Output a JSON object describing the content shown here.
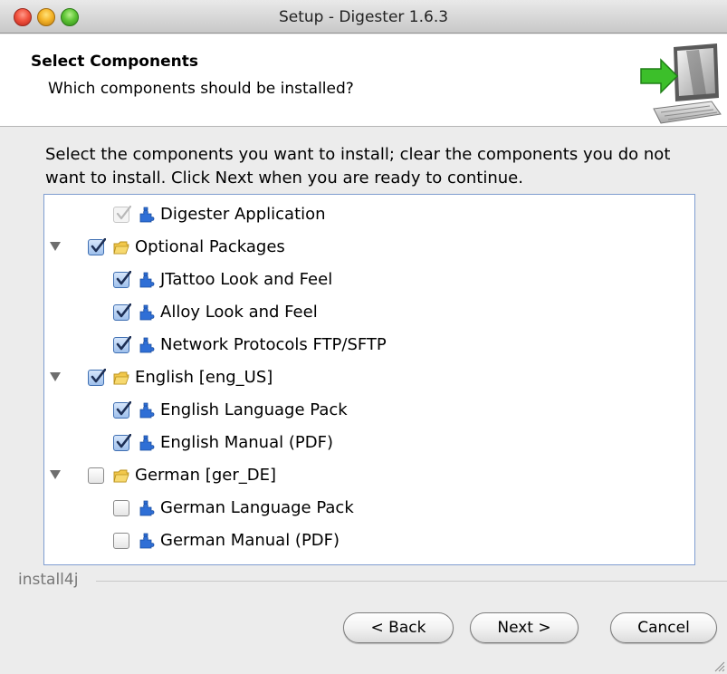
{
  "window": {
    "title": "Setup - Digester 1.6.3"
  },
  "header": {
    "title": "Select Components",
    "subtitle": "Which components should be installed?",
    "icon": "computer-install-arrow-icon"
  },
  "instructions": "Select the components you want to install; clear the components you do not want to install. Click Next when you are ready to continue.",
  "tree": {
    "items": [
      {
        "label": "Digester Application",
        "level": 1,
        "expandable": false,
        "checked": true,
        "disabled": true,
        "icon": "puzzle-icon"
      },
      {
        "label": "Optional Packages",
        "level": 0,
        "expandable": true,
        "checked": true,
        "disabled": false,
        "icon": "folder-icon"
      },
      {
        "label": "JTattoo Look and Feel",
        "level": 1,
        "expandable": false,
        "checked": true,
        "disabled": false,
        "icon": "puzzle-icon"
      },
      {
        "label": "Alloy Look and Feel",
        "level": 1,
        "expandable": false,
        "checked": true,
        "disabled": false,
        "icon": "puzzle-icon"
      },
      {
        "label": "Network Protocols FTP/SFTP",
        "level": 1,
        "expandable": false,
        "checked": true,
        "disabled": false,
        "icon": "puzzle-icon"
      },
      {
        "label": "English [eng_US]",
        "level": 0,
        "expandable": true,
        "checked": true,
        "disabled": false,
        "icon": "folder-icon"
      },
      {
        "label": "English Language Pack",
        "level": 1,
        "expandable": false,
        "checked": true,
        "disabled": false,
        "icon": "puzzle-icon"
      },
      {
        "label": "English Manual (PDF)",
        "level": 1,
        "expandable": false,
        "checked": true,
        "disabled": false,
        "icon": "puzzle-icon"
      },
      {
        "label": "German [ger_DE]",
        "level": 0,
        "expandable": true,
        "checked": false,
        "disabled": false,
        "icon": "folder-icon"
      },
      {
        "label": "German Language Pack",
        "level": 1,
        "expandable": false,
        "checked": false,
        "disabled": false,
        "icon": "puzzle-icon"
      },
      {
        "label": "German Manual (PDF)",
        "level": 1,
        "expandable": false,
        "checked": false,
        "disabled": false,
        "icon": "puzzle-icon"
      }
    ]
  },
  "footer": {
    "brand": "install4j",
    "back_label": "< Back",
    "next_label": "Next >",
    "cancel_label": "Cancel"
  },
  "colors": {
    "check_accent": "#3f6fb2",
    "puzzle_blue": "#2f6fd6",
    "folder_yellow": "#f2c84b",
    "install_arrow_green": "#3cbf2a"
  }
}
